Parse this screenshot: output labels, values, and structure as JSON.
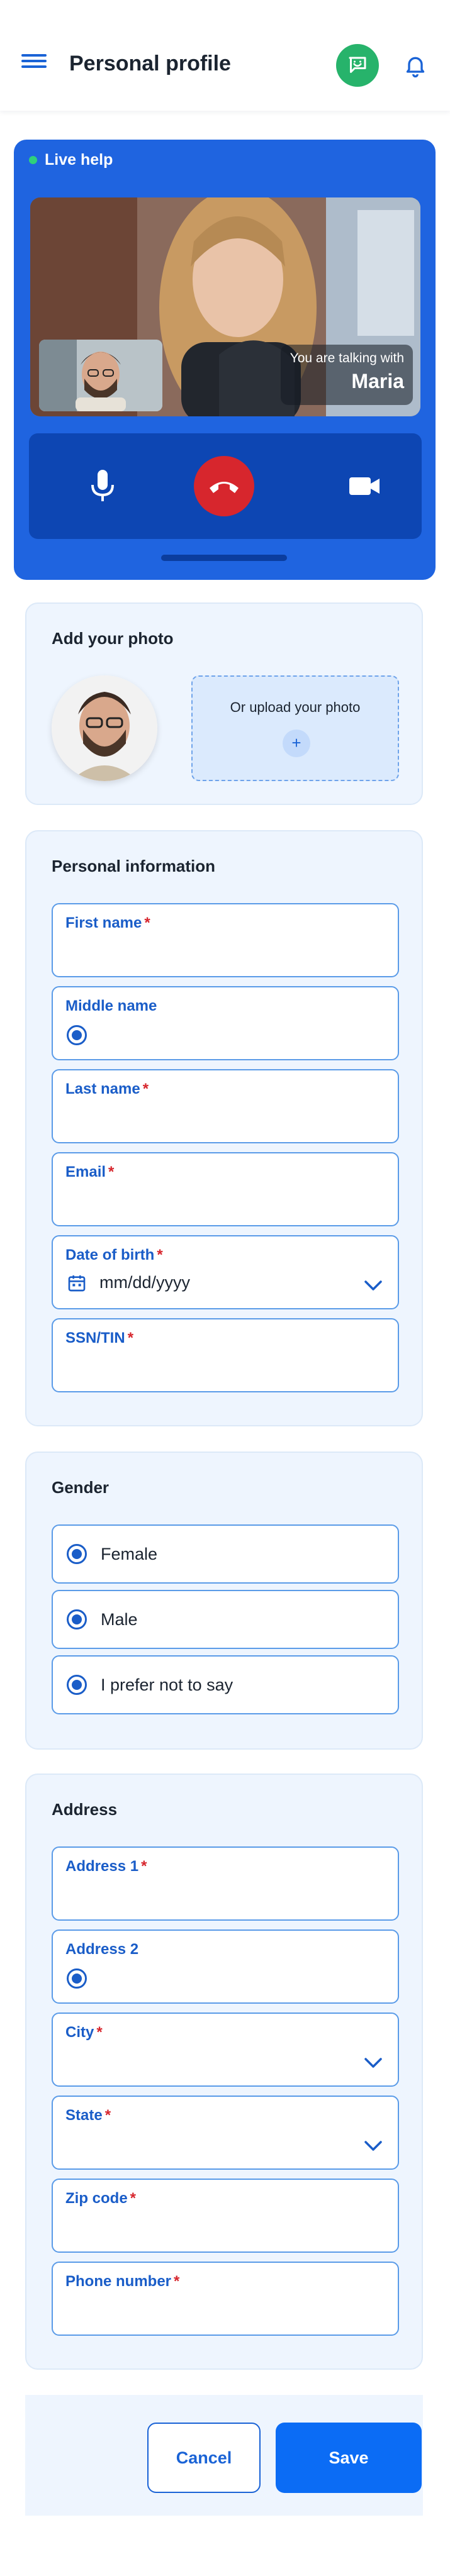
{
  "header": {
    "title": "Personal profile",
    "icons": {
      "menu": "hamburger-icon",
      "chat": "chat-support-icon",
      "notifications": "bell-icon"
    }
  },
  "live_help": {
    "label": "Live help",
    "talking_with_label": "You are talking with",
    "agent_name": "Maria",
    "controls": [
      "microphone-icon",
      "end-call-icon",
      "video-camera-icon"
    ]
  },
  "photo": {
    "title": "Add your photo",
    "upload_label": "Or upload your photo",
    "upload_plus": "+"
  },
  "personal_info": {
    "title": "Personal information",
    "fields": [
      {
        "label": "First name",
        "required": "*"
      },
      {
        "label": "Middle name",
        "required": ""
      },
      {
        "label": "Last name",
        "required": "*"
      },
      {
        "label": "Email",
        "required": "*"
      },
      {
        "label": "Date of birth",
        "required": "*",
        "value": "mm/dd/yyyy"
      },
      {
        "label": "SSN/TIN",
        "required": "*"
      }
    ]
  },
  "gender": {
    "title": "Gender",
    "options": [
      "Female",
      "Male",
      "I prefer not to say"
    ]
  },
  "address": {
    "title": "Address",
    "fields": [
      {
        "label": "Address 1",
        "required": "*"
      },
      {
        "label": "Address 2",
        "required": ""
      },
      {
        "label": "City",
        "required": "*"
      },
      {
        "label": "State",
        "required": "*"
      },
      {
        "label": "Zip code",
        "required": "*"
      },
      {
        "label": "Phone number",
        "required": "*"
      }
    ]
  },
  "actions": {
    "cancel": "Cancel",
    "save": "Save"
  },
  "colors": {
    "primary": "#1a63d6",
    "live_bg": "#1f64e0",
    "end_call": "#d7262d",
    "chat": "#27b36b",
    "required": "#d7262d"
  }
}
